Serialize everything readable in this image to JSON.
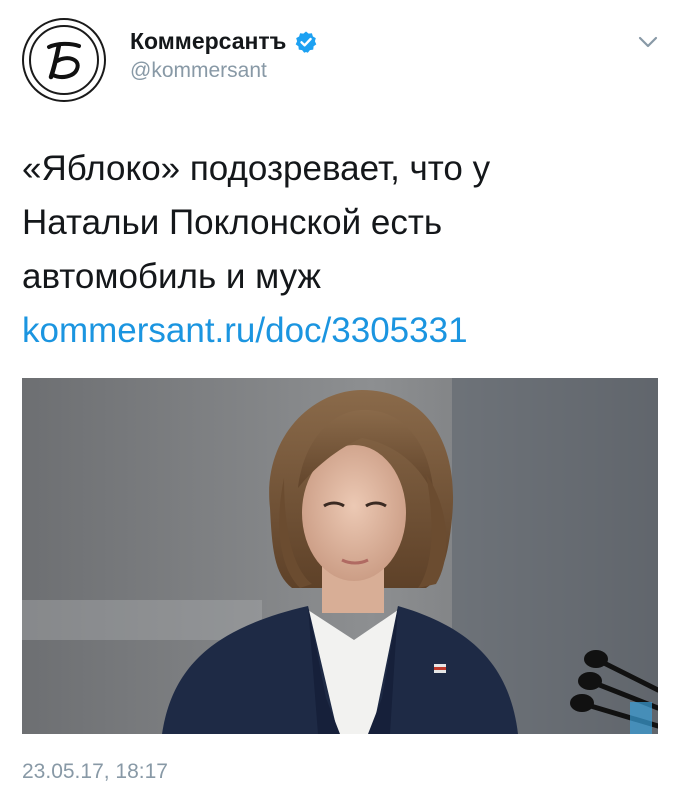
{
  "author": {
    "name": "Коммерсантъ",
    "handle": "@kommersant",
    "avatar_letter": "Ъ",
    "verified": true
  },
  "tweet": {
    "text": "«Яблоко» подозревает, что  у\nНатальи Поклонской есть\nавтомобиль и муж",
    "link": "kommersant.ru/doc/3305331",
    "timestamp": "23.05.17, 18:17"
  },
  "icons": {
    "verified": "verified-badge-icon",
    "more": "chevron-down-icon"
  },
  "colors": {
    "link": "#1b95e0",
    "verified": "#1da1f2",
    "secondary_text": "#8899a6"
  }
}
